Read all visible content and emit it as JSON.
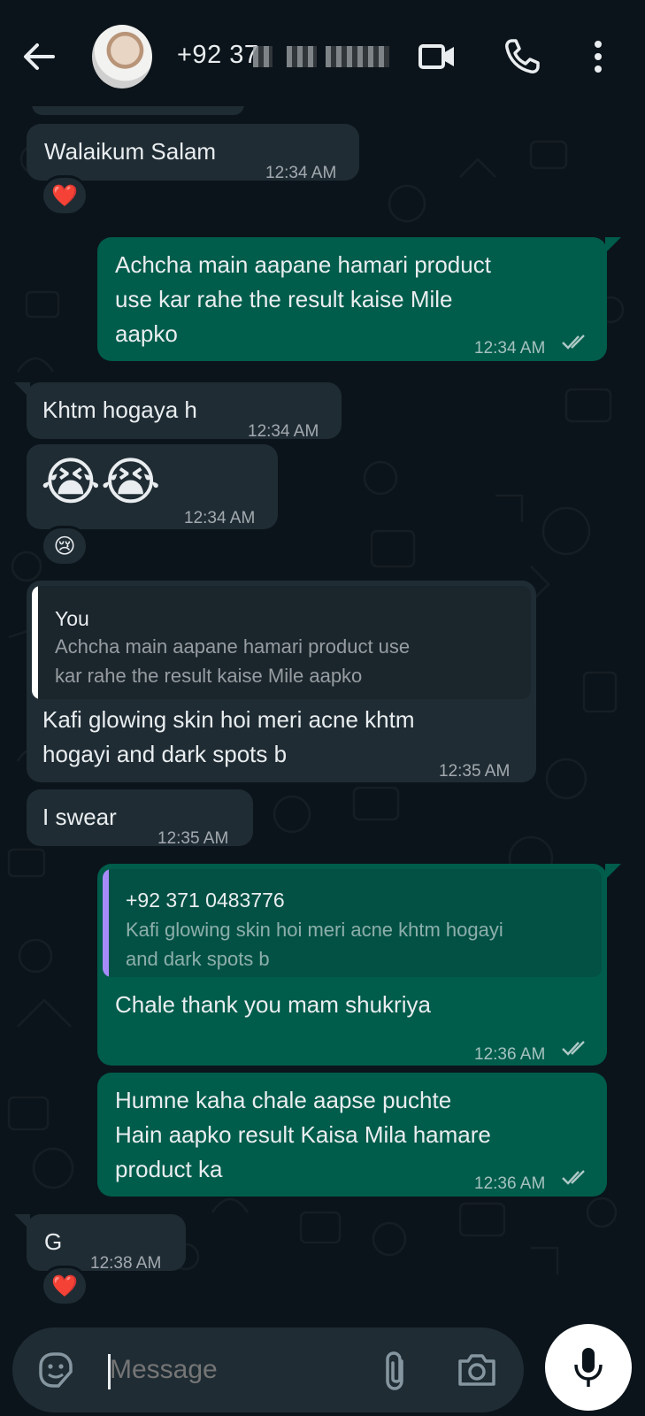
{
  "header": {
    "contact_name": "+92 37",
    "back_icon": "arrow-left-icon",
    "video_icon": "video-camera-icon",
    "call_icon": "phone-icon",
    "menu_icon": "more-vert-icon"
  },
  "messages": [
    {
      "dir": "in",
      "text": "Walaikum Salam",
      "time": "12:34 AM",
      "reaction": "❤️"
    },
    {
      "dir": "out",
      "text_lines": [
        "Achcha main aapane hamari product",
        "use kar rahe the result kaise Mile",
        "aapko"
      ],
      "time": "12:34 AM"
    },
    {
      "dir": "in",
      "text": "Khtm hogaya h",
      "time": "12:34 AM"
    },
    {
      "dir": "in",
      "text": "😭😭",
      "time": "12:34 AM",
      "reaction": "😢"
    },
    {
      "dir": "in",
      "quote_author": "You",
      "quote_lines": [
        "Achcha main aapane hamari product use",
        "kar rahe the result kaise Mile aapko"
      ],
      "text_lines": [
        "Kafi glowing skin hoi meri acne khtm",
        "hogayi and dark spots b"
      ],
      "time": "12:35 AM"
    },
    {
      "dir": "in",
      "text": "I swear",
      "time": "12:35 AM"
    },
    {
      "dir": "out",
      "quote_author": "+92 371 0483776",
      "quote_lines": [
        "Kafi glowing skin hoi meri acne khtm hogayi",
        "and dark spots b"
      ],
      "text": "Chale thank you mam shukriya",
      "time": "12:36 AM"
    },
    {
      "dir": "out",
      "text_lines": [
        "Humne kaha chale aapse puchte",
        "Hain aapko result Kaisa Mila hamare",
        "product ka"
      ],
      "time": "12:36 AM"
    },
    {
      "dir": "in",
      "text": "G",
      "time": "12:38 AM",
      "reaction": "❤️"
    }
  ],
  "composer": {
    "placeholder": "Message",
    "sticker_icon": "sticker-icon",
    "attach_icon": "paperclip-icon",
    "camera_icon": "camera-icon",
    "mic_icon": "microphone-icon"
  },
  "colors": {
    "background": "#0b141a",
    "incoming": "#1f2c34",
    "outgoing": "#005c4b",
    "quote_you_bar": "#ffffff",
    "quote_contact_bar": "#a78bfa"
  }
}
